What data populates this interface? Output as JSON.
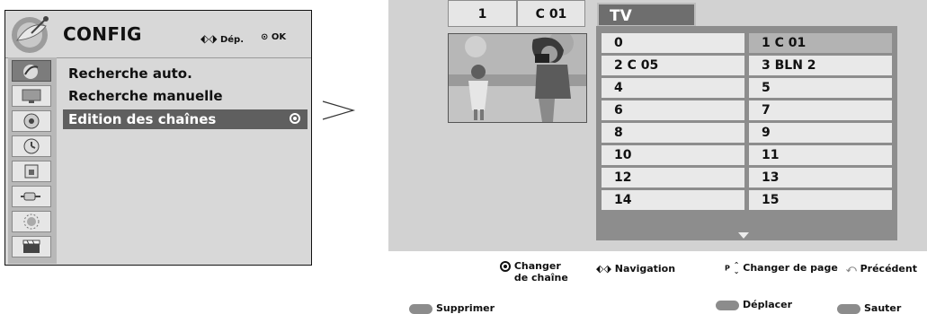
{
  "menu": {
    "title": "CONFIG",
    "hint_move": "Dép.",
    "hint_ok": "OK",
    "icons": [
      "satellite-dish-icon",
      "monitor-icon",
      "speaker-icon",
      "clock-icon",
      "lock-icon",
      "input-plug-icon",
      "sun-icon",
      "clapperboard-icon"
    ],
    "items": [
      "Recherche auto.",
      "Recherche manuelle",
      "Edition des chaînes"
    ],
    "selected_index": 2
  },
  "panel": {
    "top_number": "1",
    "top_channel": "C 01",
    "tab": "TV",
    "channels": [
      [
        "0",
        "1 C 01"
      ],
      [
        "2 C 05",
        "3 BLN 2"
      ],
      [
        "4",
        "5"
      ],
      [
        "6",
        "7"
      ],
      [
        "8",
        "9"
      ],
      [
        "10",
        "11"
      ],
      [
        "12",
        "13"
      ],
      [
        "14",
        "15"
      ]
    ]
  },
  "hints": {
    "change_channel": "Changer de chaîne",
    "navigation": "Navigation",
    "change_page": "Changer de page",
    "page_key": "P",
    "back": "Précédent",
    "delete": "Supprimer",
    "move": "Déplacer",
    "skip": "Sauter"
  },
  "colors": {
    "selected_row": "#5f5f5f",
    "tab_bg": "#6e6e6e",
    "panel_bg": "#d2d2d2"
  }
}
